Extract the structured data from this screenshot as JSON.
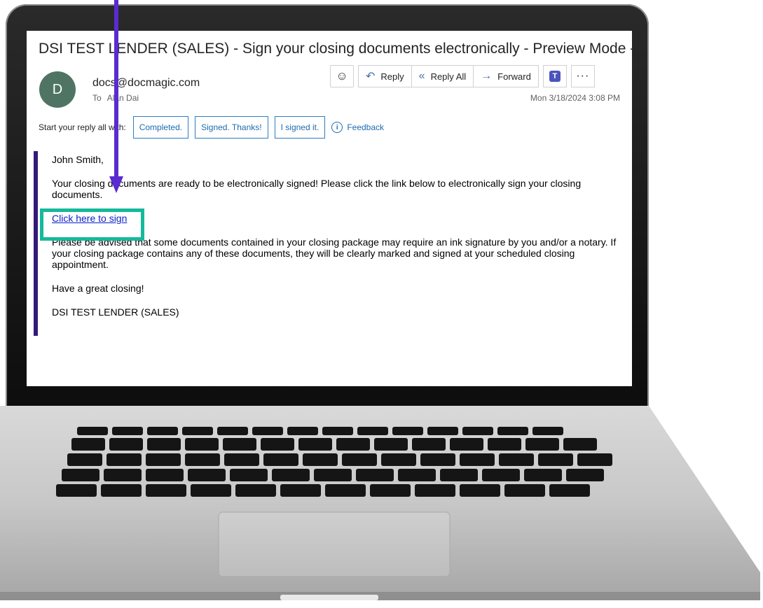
{
  "email": {
    "subject": "DSI TEST LENDER (SALES) - Sign your closing documents electronically - Preview Mode - ...",
    "avatar_initial": "D",
    "from": "docs@docmagic.com",
    "to_label": "To",
    "to": "Alan Dai",
    "date": "Mon 3/18/2024 3:08 PM"
  },
  "toolbar": {
    "emoji_icon": "smiley-icon",
    "reply_label": "Reply",
    "reply_all_label": "Reply All",
    "forward_label": "Forward",
    "teams_icon": "teams-icon",
    "more_label": "···"
  },
  "quick_reply": {
    "label": "Start your reply all with:",
    "options": [
      "Completed.",
      "Signed. Thanks!",
      "I signed it."
    ],
    "feedback_label": "Feedback"
  },
  "body": {
    "greeting": "John Smith,",
    "intro": "Your closing documents are ready to be electronically signed! Please click the link below to electronically sign your closing documents.",
    "link_text": "Click here to sign",
    "advisory": "Please be advised that some documents contained in your closing package may require an ink signature by you and/or a notary. If your closing package contains any of these documents, they will be clearly marked and signed at your scheduled closing appointment.",
    "closing": "Have a great closing!",
    "signature": "DSI TEST LENDER (SALES)"
  },
  "colors": {
    "accent_bar": "#34197a",
    "highlight_box": "#16b99b",
    "arrow": "#5a2bd0",
    "link": "#0a1ec9"
  }
}
